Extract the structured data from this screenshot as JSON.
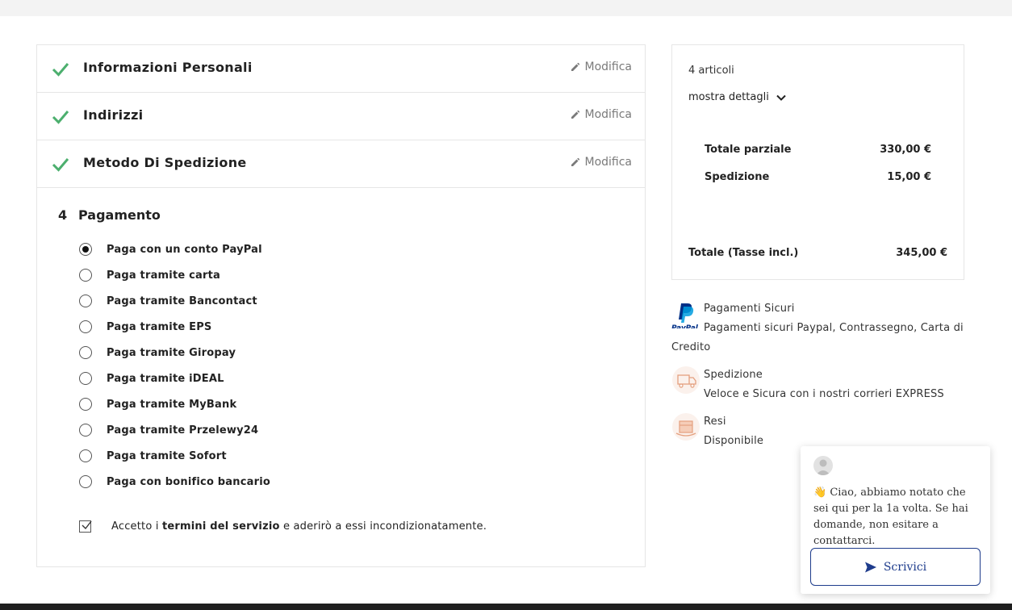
{
  "checkout": {
    "steps": [
      {
        "title": "Informazioni Personali",
        "edit_label": "Modifica"
      },
      {
        "title": "Indirizzi",
        "edit_label": "Modifica"
      },
      {
        "title": "Metodo Di Spedizione",
        "edit_label": "Modifica"
      }
    ],
    "payment": {
      "number": "4",
      "title": "Pagamento",
      "selected_index": 0,
      "options": [
        "Paga con un conto PayPal",
        "Paga tramite carta",
        "Paga tramite Bancontact",
        "Paga tramite EPS",
        "Paga tramite Giropay",
        "Paga tramite iDEAL",
        "Paga tramite MyBank",
        "Paga tramite Przelewy24",
        "Paga tramite Sofort",
        "Paga con bonifico bancario"
      ],
      "terms": {
        "prefix": "Accetto i ",
        "link": "termini del servizio",
        "suffix": " e aderirò a essi incondizionatamente.",
        "checked": true
      }
    }
  },
  "summary": {
    "items_count": "4 articoli",
    "show_details": "mostra dettagli",
    "subtotal_label": "Totale parziale",
    "subtotal_value": "330,00 €",
    "shipping_label": "Spedizione",
    "shipping_value": "15,00 €",
    "total_label": "Totale (Tasse incl.)",
    "total_value": "345,00 €"
  },
  "reassurance": [
    {
      "icon": "paypal-logo",
      "title": "Pagamenti Sicuri",
      "text": "Pagamenti sicuri Paypal, Contrassegno, Carta di Credito"
    },
    {
      "icon": "delivery-truck-icon",
      "title": "Spedizione",
      "text": "Veloce e Sicura con i nostri corrieri EXPRESS"
    },
    {
      "icon": "return-box-icon",
      "title": "Resi",
      "text": "Disponibile"
    }
  ],
  "chat": {
    "emoji": "👋",
    "message": "Ciao, abbiamo notato che sei qui per la 1a volta. Se hai domande, non esitare a contattarci.",
    "button_label": "Scrivici"
  },
  "colors": {
    "check_green": "#4caf6e",
    "chat_accent": "#1e3c8c",
    "paypal_dark": "#003087",
    "paypal_light": "#009cde"
  }
}
